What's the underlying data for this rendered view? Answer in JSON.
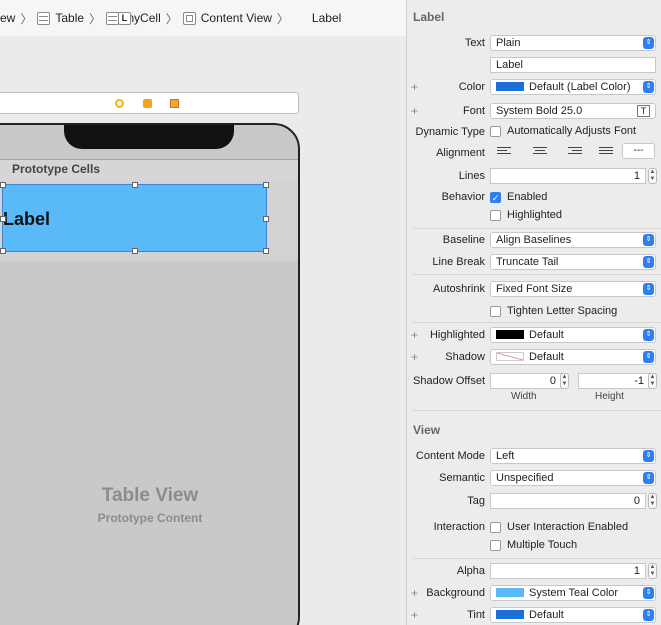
{
  "breadcrumb": {
    "items": [
      {
        "label": "ew",
        "icon": ""
      },
      {
        "label": "Table",
        "icon": "table-icon"
      },
      {
        "label": "myCell",
        "icon": "table-icon"
      },
      {
        "label": "Content View",
        "icon": "view-icon"
      },
      {
        "label": "Label",
        "icon": "label-icon",
        "icon_text": "L"
      }
    ]
  },
  "canvas": {
    "header_label": "Prototype Cells",
    "cell_label": "Label",
    "table_view_title": "Table View",
    "table_view_subtitle": "Prototype Content"
  },
  "inspector": {
    "label_section": {
      "title": "Label",
      "text_label": "Text",
      "text_value": "Plain",
      "text_content": "Label",
      "color_label": "Color",
      "color_value": "Default (Label Color)",
      "color_swatch": "#1a6fd8",
      "font_label": "Font",
      "font_value": "System Bold 25.0",
      "dynamic_type_label": "Dynamic Type",
      "dynamic_type_value": "Automatically Adjusts Font",
      "alignment_label": "Alignment",
      "alignment_last": "---",
      "lines_label": "Lines",
      "lines_value": "1",
      "behavior_label": "Behavior",
      "behavior_enabled": "Enabled",
      "behavior_highlighted": "Highlighted",
      "baseline_label": "Baseline",
      "baseline_value": "Align Baselines",
      "line_break_label": "Line Break",
      "line_break_value": "Truncate Tail",
      "autoshrink_label": "Autoshrink",
      "autoshrink_value": "Fixed Font Size",
      "tighten_label": "Tighten Letter Spacing",
      "highlighted_label": "Highlighted",
      "highlighted_value": "Default",
      "highlighted_swatch": "#000000",
      "shadow_label": "Shadow",
      "shadow_value": "Default",
      "shadow_offset_label": "Shadow Offset",
      "shadow_width": "0",
      "shadow_height": "-1",
      "width_caption": "Width",
      "height_caption": "Height"
    },
    "view_section": {
      "title": "View",
      "content_mode_label": "Content Mode",
      "content_mode_value": "Left",
      "semantic_label": "Semantic",
      "semantic_value": "Unspecified",
      "tag_label": "Tag",
      "tag_value": "0",
      "interaction_label": "Interaction",
      "interaction_user": "User Interaction Enabled",
      "interaction_multi": "Multiple Touch",
      "alpha_label": "Alpha",
      "alpha_value": "1",
      "background_label": "Background",
      "background_value": "System Teal Color",
      "background_swatch": "#5ab9f8",
      "tint_label": "Tint",
      "tint_value": "Default",
      "tint_swatch": "#1a6fd8"
    }
  }
}
